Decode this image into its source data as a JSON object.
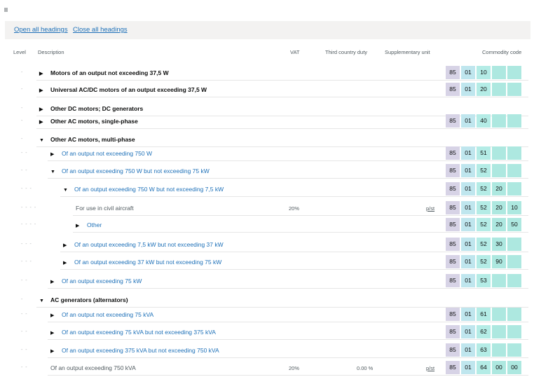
{
  "toolbar": {
    "open_all": "Open all headings",
    "close_all": "Close all headings"
  },
  "headers": {
    "level": "Level",
    "description": "Description",
    "vat": "VAT",
    "third_country_duty": "Third country duty",
    "supplementary_unit": "Supplementary unit",
    "commodity_code": "Commodity code"
  },
  "rows": [
    {
      "level": 1,
      "dots": "-",
      "icon": "triangle-right-icon",
      "glyph": "▶",
      "style": "bold",
      "description": "Motors of an output not exceeding 37,5 W",
      "vat": "",
      "duty": "",
      "unit": "",
      "code": [
        "85",
        "01",
        "10",
        "",
        ""
      ]
    },
    {
      "level": 1,
      "dots": "-",
      "icon": "triangle-right-icon",
      "glyph": "▶",
      "style": "bold",
      "description": "Universal AC/DC motors of an output exceeding 37,5 W",
      "vat": "",
      "duty": "",
      "unit": "",
      "code": [
        "85",
        "01",
        "20",
        "",
        ""
      ]
    },
    {
      "level": 1,
      "dots": "-",
      "icon": "triangle-right-icon",
      "glyph": "▶",
      "style": "bold",
      "description": "Other DC motors; DC generators",
      "vat": "",
      "duty": "",
      "unit": "",
      "code": []
    },
    {
      "level": 1,
      "dots": "-",
      "icon": "triangle-right-icon",
      "glyph": "▶",
      "style": "bold",
      "description": "Other AC motors, single-phase",
      "vat": "",
      "duty": "",
      "unit": "",
      "code": [
        "85",
        "01",
        "40",
        "",
        ""
      ]
    },
    {
      "level": 1,
      "dots": "-",
      "icon": "triangle-down-icon",
      "glyph": "▼",
      "style": "bold",
      "description": "Other AC motors, multi-phase",
      "vat": "",
      "duty": "",
      "unit": "",
      "code": []
    },
    {
      "level": 2,
      "dots": "- -",
      "icon": "triangle-right-icon",
      "glyph": "▶",
      "style": "link",
      "description": "Of an output not exceeding 750 W",
      "vat": "",
      "duty": "",
      "unit": "",
      "code": [
        "85",
        "01",
        "51",
        "",
        ""
      ]
    },
    {
      "level": 2,
      "dots": "- -",
      "icon": "triangle-down-icon",
      "glyph": "▼",
      "style": "link",
      "description": "Of an output exceeding 750 W but not exceeding 75 kW",
      "vat": "",
      "duty": "",
      "unit": "",
      "code": [
        "85",
        "01",
        "52",
        "",
        ""
      ]
    },
    {
      "level": 3,
      "dots": "- - -",
      "icon": "triangle-down-icon",
      "glyph": "▼",
      "style": "link",
      "description": "Of an output exceeding 750 W but not exceeding 7,5 kW",
      "vat": "",
      "duty": "",
      "unit": "",
      "code": [
        "85",
        "01",
        "52",
        "20",
        ""
      ]
    },
    {
      "level": 4,
      "dots": "- - - -",
      "icon": "",
      "glyph": "",
      "style": "plain",
      "description": "For use in civil aircraft",
      "vat": "20%",
      "duty": "",
      "unit": "p/st",
      "code": [
        "85",
        "01",
        "52",
        "20",
        "10"
      ]
    },
    {
      "level": 4,
      "dots": "- - - -",
      "icon": "triangle-right-icon",
      "glyph": "▶",
      "style": "link",
      "description": "Other",
      "vat": "",
      "duty": "",
      "unit": "",
      "code": [
        "85",
        "01",
        "52",
        "20",
        "50"
      ]
    },
    {
      "level": 3,
      "dots": "- - -",
      "icon": "triangle-right-icon",
      "glyph": "▶",
      "style": "link",
      "description": "Of an output exceeding 7,5 kW but not exceeding 37 kW",
      "vat": "",
      "duty": "",
      "unit": "",
      "code": [
        "85",
        "01",
        "52",
        "30",
        ""
      ]
    },
    {
      "level": 3,
      "dots": "- - -",
      "icon": "triangle-right-icon",
      "glyph": "▶",
      "style": "link",
      "description": "Of an output exceeding 37 kW but not exceeding 75 kW",
      "vat": "",
      "duty": "",
      "unit": "",
      "code": [
        "85",
        "01",
        "52",
        "90",
        ""
      ]
    },
    {
      "level": 2,
      "dots": "- -",
      "icon": "triangle-right-icon",
      "glyph": "▶",
      "style": "link",
      "description": "Of an output exceeding 75 kW",
      "vat": "",
      "duty": "",
      "unit": "",
      "code": [
        "85",
        "01",
        "53",
        "",
        ""
      ]
    },
    {
      "level": 1,
      "dots": "-",
      "icon": "triangle-down-icon",
      "glyph": "▼",
      "style": "bold",
      "description": "AC generators (alternators)",
      "vat": "",
      "duty": "",
      "unit": "",
      "code": []
    },
    {
      "level": 2,
      "dots": "- -",
      "icon": "triangle-right-icon",
      "glyph": "▶",
      "style": "link",
      "description": "Of an output not exceeding 75 kVA",
      "vat": "",
      "duty": "",
      "unit": "",
      "code": [
        "85",
        "01",
        "61",
        "",
        ""
      ]
    },
    {
      "level": 2,
      "dots": "- -",
      "icon": "triangle-right-icon",
      "glyph": "▶",
      "style": "link",
      "description": "Of an output exceeding 75 kVA but not exceeding 375 kVA",
      "vat": "",
      "duty": "",
      "unit": "",
      "code": [
        "85",
        "01",
        "62",
        "",
        ""
      ]
    },
    {
      "level": 2,
      "dots": "- -",
      "icon": "triangle-right-icon",
      "glyph": "▶",
      "style": "link",
      "description": "Of an output exceeding 375 kVA but not exceeding 750 kVA",
      "vat": "",
      "duty": "",
      "unit": "",
      "code": [
        "85",
        "01",
        "63",
        "",
        ""
      ]
    },
    {
      "level": 2,
      "dots": "- -",
      "icon": "",
      "glyph": "",
      "style": "plain",
      "description": "Of an output exceeding 750 kVA",
      "vat": "20%",
      "duty": "0.00 %",
      "unit": "p/st",
      "code": [
        "85",
        "01",
        "64",
        "00",
        "00"
      ]
    }
  ]
}
